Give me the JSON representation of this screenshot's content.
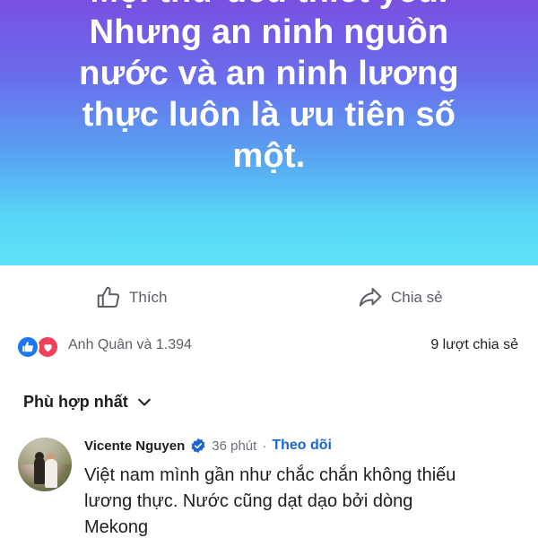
{
  "post": {
    "banner_lines": [
      "Mọi thứ đều thiết yếu.",
      "Nhưng an ninh nguồn",
      "nước và an ninh lương",
      "thực luôn là ưu tiên số",
      "một."
    ]
  },
  "actions": {
    "like_label": "Thích",
    "share_label": "Chia sẻ"
  },
  "reactions": {
    "summary": "Anh Quân và 1.394",
    "shares": "9 lượt chia sẻ",
    "types": [
      "like",
      "love"
    ]
  },
  "comments_sort": {
    "label": "Phù hợp nhất"
  },
  "comment": {
    "author": "Vicente Nguyen",
    "verified": true,
    "time": "36 phút",
    "separator": "·",
    "follow_label": "Theo dõi",
    "text_lines": [
      "Việt nam mình gần như chắc chắn không thiếu",
      "lương thực. Nước cũng dạt dạo bởi dòng",
      "Mekong"
    ]
  },
  "colors": {
    "banner_top": "#7a4fe0",
    "banner_bottom": "#5ee2f8",
    "like_blue": "#1e77f2",
    "love_red": "#f0405a",
    "follow_blue": "#1b66d2"
  }
}
